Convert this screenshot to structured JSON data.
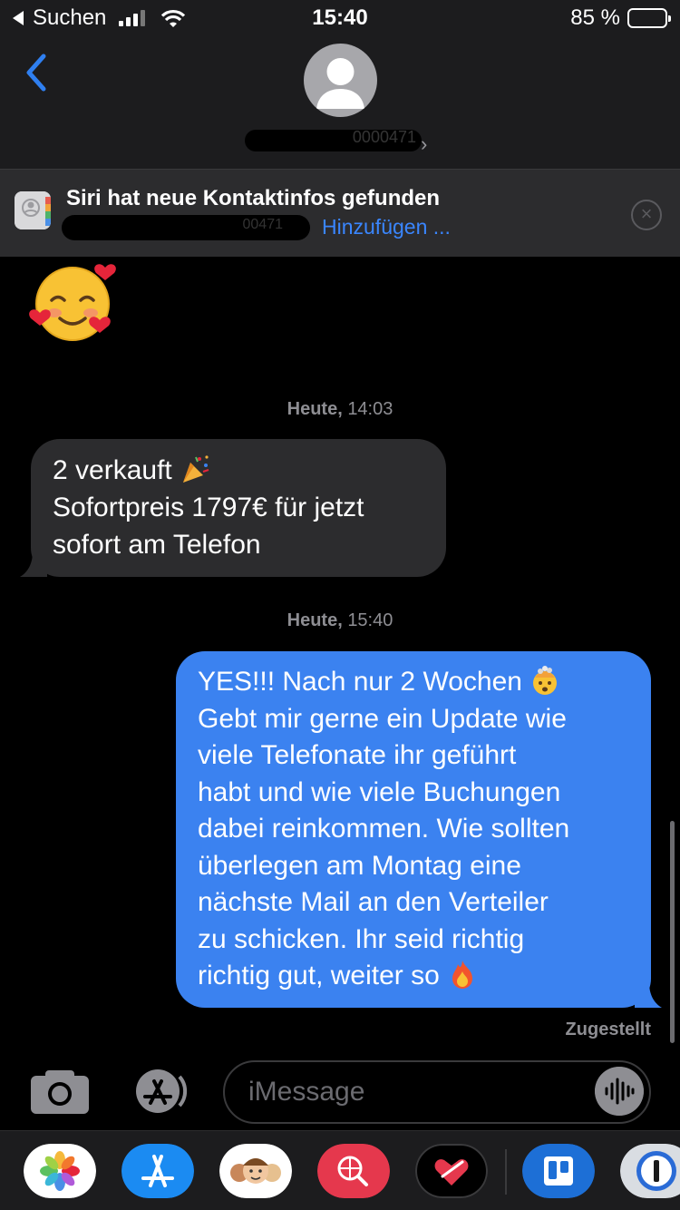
{
  "status_bar": {
    "back_app": "Suchen",
    "time": "15:40",
    "battery_percent": "85 %",
    "battery_level": 0.85
  },
  "header": {
    "contact_name_partial": "0000471"
  },
  "siri_banner": {
    "title": "Siri hat neue Kontaktinfos gefunden",
    "redacted_number_partial": "00471",
    "add_link": "Hinzufügen ..."
  },
  "messages": [
    {
      "type": "emoji",
      "direction": "incoming",
      "emoji": "smiling-face-with-hearts"
    },
    {
      "type": "timestamp",
      "day": "Heute,",
      "time": "14:03"
    },
    {
      "type": "text",
      "direction": "incoming",
      "lines": [
        "2 verkauft",
        "Sofortpreis 1797€ für jetzt",
        "sofort am Telefon"
      ],
      "emoji": "party-popper"
    },
    {
      "type": "timestamp",
      "day": "Heute,",
      "time": "15:40"
    },
    {
      "type": "text",
      "direction": "outgoing",
      "lines": [
        "YES!!! Nach nur 2 Wochen",
        "Gebt mir gerne ein Update wie",
        "viele Telefonate ihr geführt",
        "habt und wie viele Buchungen",
        "dabei reinkommen. Wie sollten",
        "überlegen am Montag eine",
        "nächste Mail an den Verteiler",
        "zu schicken. Ihr seid richtig",
        "richtig gut, weiter so"
      ],
      "emojis": [
        "exploding-head",
        "fire"
      ]
    }
  ],
  "delivery_status": "Zugestellt",
  "input": {
    "placeholder": "iMessage"
  },
  "app_drawer": {
    "apps": [
      "photos-icon",
      "app-store-icon",
      "memoji-icon",
      "web-search-icon",
      "digital-touch-icon",
      "trello-icon",
      "1password-icon"
    ]
  },
  "colors": {
    "outgoing_bubble": "#3b82f0",
    "incoming_bubble": "#2c2c2e",
    "link_blue": "#3a86ff"
  }
}
